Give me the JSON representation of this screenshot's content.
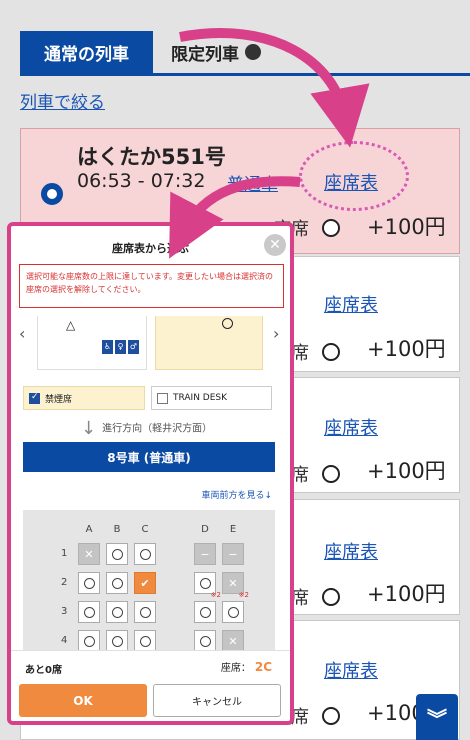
{
  "tabs": {
    "active": "通常の列車",
    "other": "限定列車"
  },
  "filter_link": "列車で絞る",
  "train": {
    "name": "はくたか551号",
    "time": "06:53 - 07:32",
    "type": "普通車"
  },
  "seat_map_link": "座席表",
  "seat_label": "席",
  "first_seat_label": "座席",
  "price": "+100円",
  "modal": {
    "title": "座席表から選ぶ",
    "warning": "選択可能な座席数の上限に達しています。変更したい場合は選択済の座席の選択を解除してください。",
    "filter_nonsmoking": "禁煙席",
    "filter_desk": "TRAIN DESK",
    "direction": "進行方向（軽井沢方面）",
    "car_title": "8号車 (普通車)",
    "front_link": "車両前方を見る↓",
    "columns": [
      "A",
      "B",
      "C",
      "D",
      "E"
    ],
    "rows": [
      "1",
      "2",
      "3",
      "4"
    ],
    "remaining": "あと0席",
    "seat_label": "座席：",
    "selected_seat": "2C",
    "ok": "OK",
    "cancel": "キャンセル",
    "ref_mark": "※2"
  },
  "colors": {
    "brand": "#0b4aa2",
    "accent": "#f08a3e",
    "highlight": "#d8418a"
  }
}
